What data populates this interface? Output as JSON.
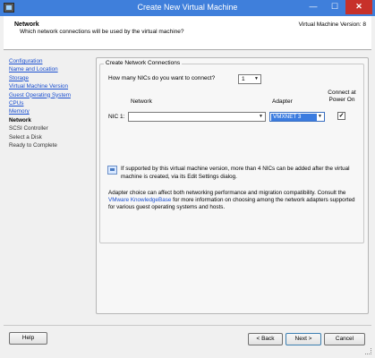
{
  "window": {
    "title": "Create New Virtual Machine",
    "minimize_glyph": "—",
    "maximize_glyph": "☐",
    "close_glyph": "✕"
  },
  "header": {
    "title": "Network",
    "subtitle": "Which network connections will be used by the virtual machine?",
    "version": "Virtual Machine Version: 8"
  },
  "nav": {
    "items": [
      {
        "label": "Configuration",
        "state": "link"
      },
      {
        "label": "Name and Location",
        "state": "link"
      },
      {
        "label": "Storage",
        "state": "link"
      },
      {
        "label": "Virtual Machine Version",
        "state": "link"
      },
      {
        "label": "Guest Operating System",
        "state": "link"
      },
      {
        "label": "CPUs",
        "state": "link"
      },
      {
        "label": "Memory",
        "state": "link"
      },
      {
        "label": "Network",
        "state": "current"
      },
      {
        "label": "SCSI Controller",
        "state": "pending"
      },
      {
        "label": "Select a Disk",
        "state": "pending"
      },
      {
        "label": "Ready to Complete",
        "state": "pending"
      }
    ]
  },
  "content": {
    "group_title": "Create Network Connections",
    "question": "How many NICs do you want to connect?",
    "nic_count": "1",
    "columns": {
      "network": "Network",
      "adapter": "Adapter",
      "connect": "Connect at Power On"
    },
    "nic": {
      "label": "NIC 1:",
      "network_value": "",
      "adapter_value": "VMXNET 3",
      "connect_checked": true
    },
    "info_text": "If supported by this virtual machine version, more than 4 NICs can be added after the virtual machine is created, via its Edit Settings dialog.",
    "adapter_text_before": "Adapter choice can affect both networking performance and migration compatibility. Consult the ",
    "adapter_link": "VMware KnowledgeBase",
    "adapter_text_after": " for more information on choosing among the network adapters supported for various guest operating systems and hosts."
  },
  "footer": {
    "help": "Help",
    "back": "< Back",
    "next": "Next >",
    "cancel": "Cancel"
  },
  "icons": {
    "dropdown": "▼",
    "checkmark": "✓"
  },
  "colors": {
    "titlebar": "#3f7fdb",
    "close_button": "#c7312a",
    "link": "#1a4fd0",
    "selection": "#3b7ce0"
  }
}
